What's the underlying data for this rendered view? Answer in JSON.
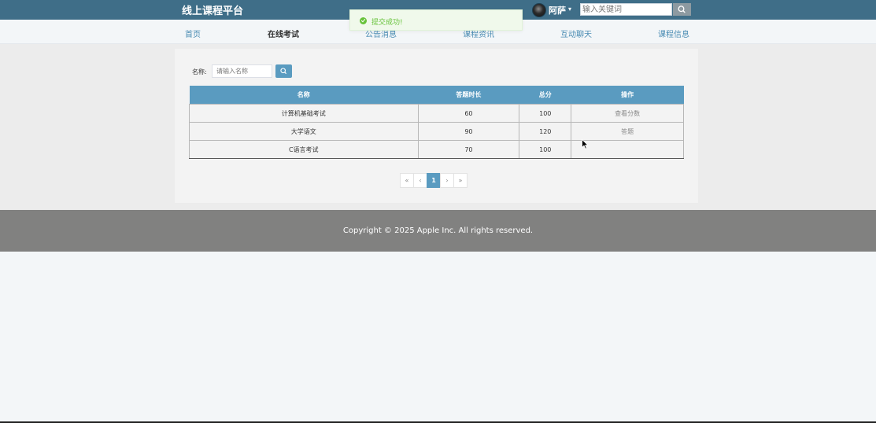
{
  "header": {
    "brand": "线上课程平台",
    "username": "阿萨",
    "user_caret": "▾",
    "search_placeholder": "输入关键词"
  },
  "nav": {
    "items": [
      {
        "label": "首页"
      },
      {
        "label": "在线考试"
      },
      {
        "label": "公告消息"
      },
      {
        "label": "课程资讯"
      },
      {
        "label": "互动聊天"
      },
      {
        "label": "课程信息"
      }
    ]
  },
  "toast": {
    "text": "提交成功!"
  },
  "filter": {
    "label": "名称:",
    "placeholder": "请输入名称"
  },
  "table": {
    "headers": [
      "名称",
      "答题时长",
      "总分",
      "操作"
    ],
    "rows": [
      {
        "name": "计算机基础考试",
        "duration": "60",
        "score": "100",
        "op": "查看分数"
      },
      {
        "name": "大学语文",
        "duration": "90",
        "score": "120",
        "op": "答题"
      },
      {
        "name": "C语言考试",
        "duration": "70",
        "score": "100",
        "op": ""
      }
    ]
  },
  "pagination": {
    "first": "«",
    "prev": "‹",
    "current": "1",
    "next": "›",
    "last": "»"
  },
  "footer": {
    "copyright": "Copyright © 2025 Apple Inc. All rights reserved."
  },
  "colors": {
    "topbar": "#3f6e88",
    "accent": "#5a9bc0",
    "footer": "#818180",
    "success": "#67c23a"
  }
}
